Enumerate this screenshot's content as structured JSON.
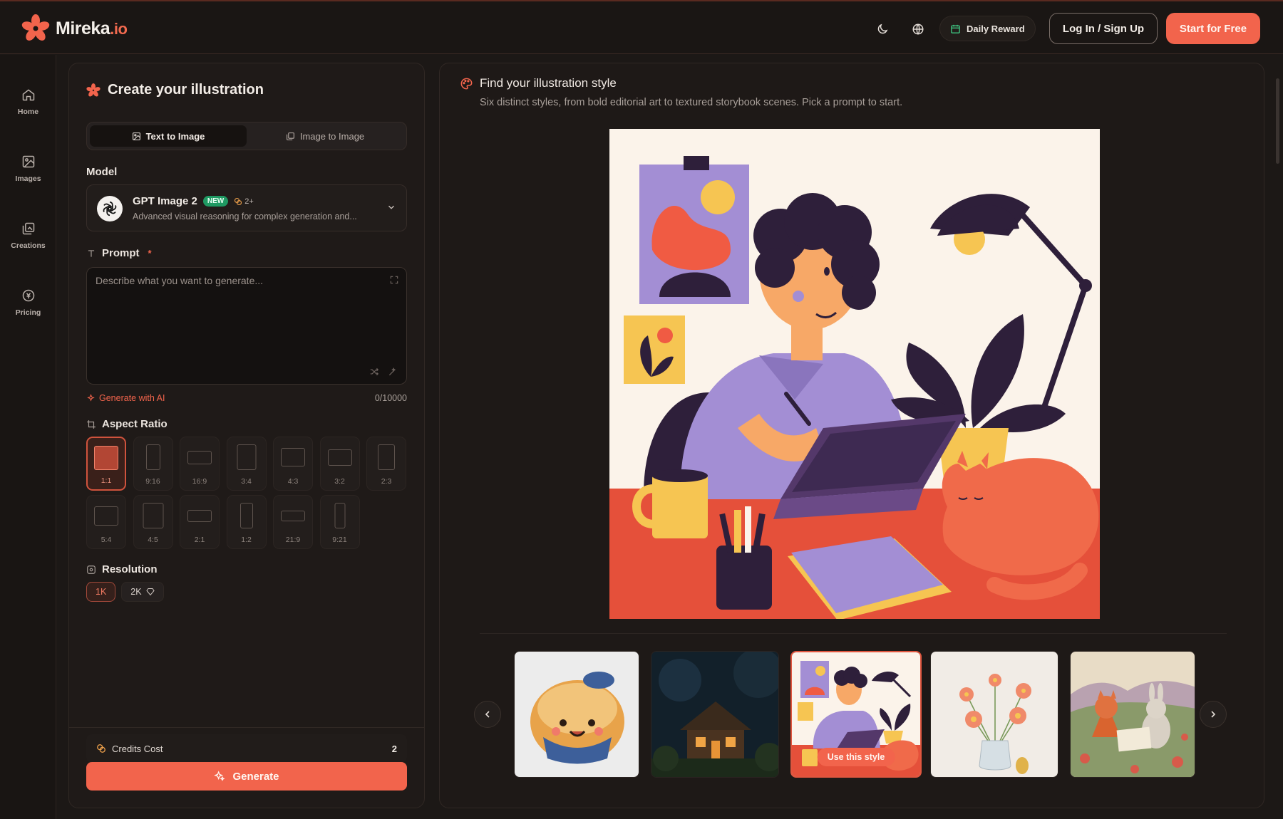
{
  "brand": {
    "name": "Mireka",
    "tld": ".io",
    "accent": "#f2644c"
  },
  "header": {
    "daily_reward": "Daily Reward",
    "login": "Log In / Sign Up",
    "start": "Start for Free"
  },
  "sidebar": {
    "items": [
      {
        "label": "Home",
        "icon": "home-icon"
      },
      {
        "label": "Images",
        "icon": "image-icon"
      },
      {
        "label": "Creations",
        "icon": "gallery-icon"
      },
      {
        "label": "Pricing",
        "icon": "coin-icon"
      }
    ]
  },
  "create": {
    "title": "Create your illustration",
    "tabs": [
      "Text to Image",
      "Image to Image"
    ],
    "active_tab": "Text to Image",
    "model_label": "Model",
    "model": {
      "name": "GPT Image 2",
      "badge": "NEW",
      "credits": "2+",
      "description": "Advanced visual reasoning for complex generation and..."
    },
    "prompt_label": "Prompt",
    "prompt_required": "*",
    "prompt_placeholder": "Describe what you want to generate...",
    "generate_ai": "Generate with AI",
    "char_count": "0/10000",
    "aspect_label": "Aspect Ratio",
    "aspect_ratios": [
      "1:1",
      "9:16",
      "16:9",
      "3:4",
      "4:3",
      "3:2",
      "2:3",
      "5:4",
      "4:5",
      "2:1",
      "1:2",
      "21:9",
      "9:21"
    ],
    "aspect_selected": "1:1",
    "resolution_label": "Resolution",
    "resolutions": [
      "1K",
      "2K"
    ],
    "resolution_selected": "1K",
    "credits_label": "Credits Cost",
    "credits_value": "2",
    "generate": "Generate"
  },
  "style": {
    "title": "Find your illustration style",
    "subtitle": "Six distinct styles, from bold editorial art to textured storybook scenes. Pick a prompt to start.",
    "use_style": "Use this style",
    "thumbnails": [
      "bun-character",
      "night-cabin",
      "illustrator-desk",
      "flower-vase",
      "fox-rabbit-meadow"
    ],
    "active_thumbnail": 2
  }
}
